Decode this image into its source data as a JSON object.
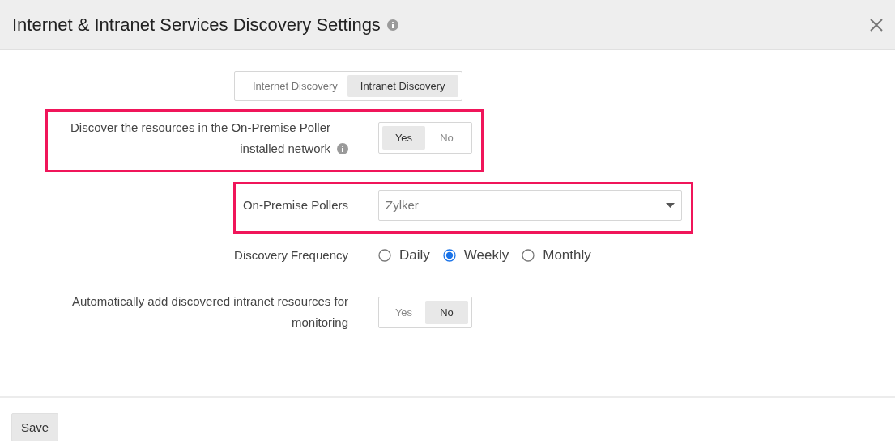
{
  "window": {
    "title": "Internet & Intranet Services Discovery Settings",
    "has_info": true
  },
  "tabs": [
    {
      "label": "Internet Discovery",
      "selected": false
    },
    {
      "label": "Intranet Discovery",
      "selected": true
    }
  ],
  "settings": [
    {
      "kind": "toggle",
      "label": "Discover the resources in the On-Premise Poller installed network",
      "has_info": true,
      "highlighted": true,
      "options": [
        {
          "label": "Yes",
          "selected": true
        },
        {
          "label": "No",
          "selected": false
        }
      ]
    },
    {
      "kind": "select",
      "label": "On-Premise Pollers",
      "highlighted": true,
      "value": "Zylker"
    },
    {
      "kind": "radio",
      "label": "Discovery Frequency",
      "highlighted": false,
      "options": [
        {
          "label": "Daily",
          "selected": false
        },
        {
          "label": "Weekly",
          "selected": true
        },
        {
          "label": "Monthly",
          "selected": false
        }
      ]
    },
    {
      "kind": "toggle",
      "label": "Automatically add discovered intranet resources for monitoring",
      "has_info": false,
      "highlighted": false,
      "options": [
        {
          "label": "Yes",
          "selected": false
        },
        {
          "label": "No",
          "selected": true
        }
      ]
    }
  ],
  "buttons": [
    "Save"
  ]
}
